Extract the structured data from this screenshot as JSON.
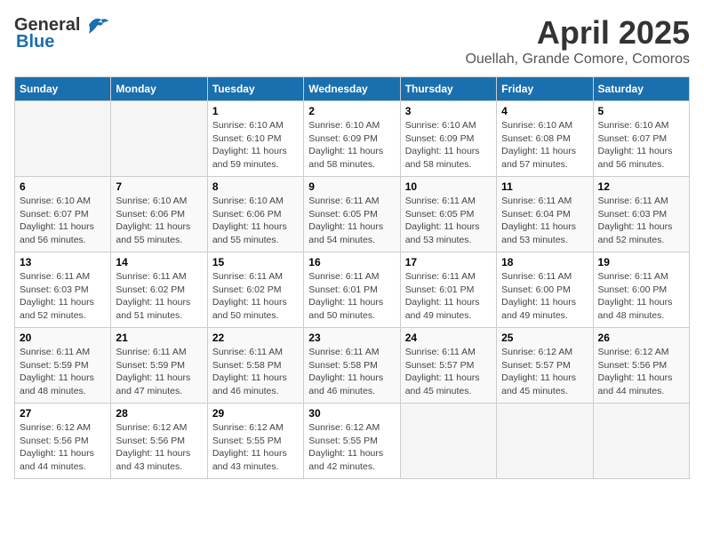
{
  "header": {
    "logo_general": "General",
    "logo_blue": "Blue",
    "title": "April 2025",
    "subtitle": "Ouellah, Grande Comore, Comoros"
  },
  "weekdays": [
    "Sunday",
    "Monday",
    "Tuesday",
    "Wednesday",
    "Thursday",
    "Friday",
    "Saturday"
  ],
  "weeks": [
    [
      {
        "day": "",
        "info": ""
      },
      {
        "day": "",
        "info": ""
      },
      {
        "day": "1",
        "sunrise": "Sunrise: 6:10 AM",
        "sunset": "Sunset: 6:10 PM",
        "daylight": "Daylight: 11 hours and 59 minutes."
      },
      {
        "day": "2",
        "sunrise": "Sunrise: 6:10 AM",
        "sunset": "Sunset: 6:09 PM",
        "daylight": "Daylight: 11 hours and 58 minutes."
      },
      {
        "day": "3",
        "sunrise": "Sunrise: 6:10 AM",
        "sunset": "Sunset: 6:09 PM",
        "daylight": "Daylight: 11 hours and 58 minutes."
      },
      {
        "day": "4",
        "sunrise": "Sunrise: 6:10 AM",
        "sunset": "Sunset: 6:08 PM",
        "daylight": "Daylight: 11 hours and 57 minutes."
      },
      {
        "day": "5",
        "sunrise": "Sunrise: 6:10 AM",
        "sunset": "Sunset: 6:07 PM",
        "daylight": "Daylight: 11 hours and 56 minutes."
      }
    ],
    [
      {
        "day": "6",
        "sunrise": "Sunrise: 6:10 AM",
        "sunset": "Sunset: 6:07 PM",
        "daylight": "Daylight: 11 hours and 56 minutes."
      },
      {
        "day": "7",
        "sunrise": "Sunrise: 6:10 AM",
        "sunset": "Sunset: 6:06 PM",
        "daylight": "Daylight: 11 hours and 55 minutes."
      },
      {
        "day": "8",
        "sunrise": "Sunrise: 6:10 AM",
        "sunset": "Sunset: 6:06 PM",
        "daylight": "Daylight: 11 hours and 55 minutes."
      },
      {
        "day": "9",
        "sunrise": "Sunrise: 6:11 AM",
        "sunset": "Sunset: 6:05 PM",
        "daylight": "Daylight: 11 hours and 54 minutes."
      },
      {
        "day": "10",
        "sunrise": "Sunrise: 6:11 AM",
        "sunset": "Sunset: 6:05 PM",
        "daylight": "Daylight: 11 hours and 53 minutes."
      },
      {
        "day": "11",
        "sunrise": "Sunrise: 6:11 AM",
        "sunset": "Sunset: 6:04 PM",
        "daylight": "Daylight: 11 hours and 53 minutes."
      },
      {
        "day": "12",
        "sunrise": "Sunrise: 6:11 AM",
        "sunset": "Sunset: 6:03 PM",
        "daylight": "Daylight: 11 hours and 52 minutes."
      }
    ],
    [
      {
        "day": "13",
        "sunrise": "Sunrise: 6:11 AM",
        "sunset": "Sunset: 6:03 PM",
        "daylight": "Daylight: 11 hours and 52 minutes."
      },
      {
        "day": "14",
        "sunrise": "Sunrise: 6:11 AM",
        "sunset": "Sunset: 6:02 PM",
        "daylight": "Daylight: 11 hours and 51 minutes."
      },
      {
        "day": "15",
        "sunrise": "Sunrise: 6:11 AM",
        "sunset": "Sunset: 6:02 PM",
        "daylight": "Daylight: 11 hours and 50 minutes."
      },
      {
        "day": "16",
        "sunrise": "Sunrise: 6:11 AM",
        "sunset": "Sunset: 6:01 PM",
        "daylight": "Daylight: 11 hours and 50 minutes."
      },
      {
        "day": "17",
        "sunrise": "Sunrise: 6:11 AM",
        "sunset": "Sunset: 6:01 PM",
        "daylight": "Daylight: 11 hours and 49 minutes."
      },
      {
        "day": "18",
        "sunrise": "Sunrise: 6:11 AM",
        "sunset": "Sunset: 6:00 PM",
        "daylight": "Daylight: 11 hours and 49 minutes."
      },
      {
        "day": "19",
        "sunrise": "Sunrise: 6:11 AM",
        "sunset": "Sunset: 6:00 PM",
        "daylight": "Daylight: 11 hours and 48 minutes."
      }
    ],
    [
      {
        "day": "20",
        "sunrise": "Sunrise: 6:11 AM",
        "sunset": "Sunset: 5:59 PM",
        "daylight": "Daylight: 11 hours and 48 minutes."
      },
      {
        "day": "21",
        "sunrise": "Sunrise: 6:11 AM",
        "sunset": "Sunset: 5:59 PM",
        "daylight": "Daylight: 11 hours and 47 minutes."
      },
      {
        "day": "22",
        "sunrise": "Sunrise: 6:11 AM",
        "sunset": "Sunset: 5:58 PM",
        "daylight": "Daylight: 11 hours and 46 minutes."
      },
      {
        "day": "23",
        "sunrise": "Sunrise: 6:11 AM",
        "sunset": "Sunset: 5:58 PM",
        "daylight": "Daylight: 11 hours and 46 minutes."
      },
      {
        "day": "24",
        "sunrise": "Sunrise: 6:11 AM",
        "sunset": "Sunset: 5:57 PM",
        "daylight": "Daylight: 11 hours and 45 minutes."
      },
      {
        "day": "25",
        "sunrise": "Sunrise: 6:12 AM",
        "sunset": "Sunset: 5:57 PM",
        "daylight": "Daylight: 11 hours and 45 minutes."
      },
      {
        "day": "26",
        "sunrise": "Sunrise: 6:12 AM",
        "sunset": "Sunset: 5:56 PM",
        "daylight": "Daylight: 11 hours and 44 minutes."
      }
    ],
    [
      {
        "day": "27",
        "sunrise": "Sunrise: 6:12 AM",
        "sunset": "Sunset: 5:56 PM",
        "daylight": "Daylight: 11 hours and 44 minutes."
      },
      {
        "day": "28",
        "sunrise": "Sunrise: 6:12 AM",
        "sunset": "Sunset: 5:56 PM",
        "daylight": "Daylight: 11 hours and 43 minutes."
      },
      {
        "day": "29",
        "sunrise": "Sunrise: 6:12 AM",
        "sunset": "Sunset: 5:55 PM",
        "daylight": "Daylight: 11 hours and 43 minutes."
      },
      {
        "day": "30",
        "sunrise": "Sunrise: 6:12 AM",
        "sunset": "Sunset: 5:55 PM",
        "daylight": "Daylight: 11 hours and 42 minutes."
      },
      {
        "day": "",
        "info": ""
      },
      {
        "day": "",
        "info": ""
      },
      {
        "day": "",
        "info": ""
      }
    ]
  ]
}
